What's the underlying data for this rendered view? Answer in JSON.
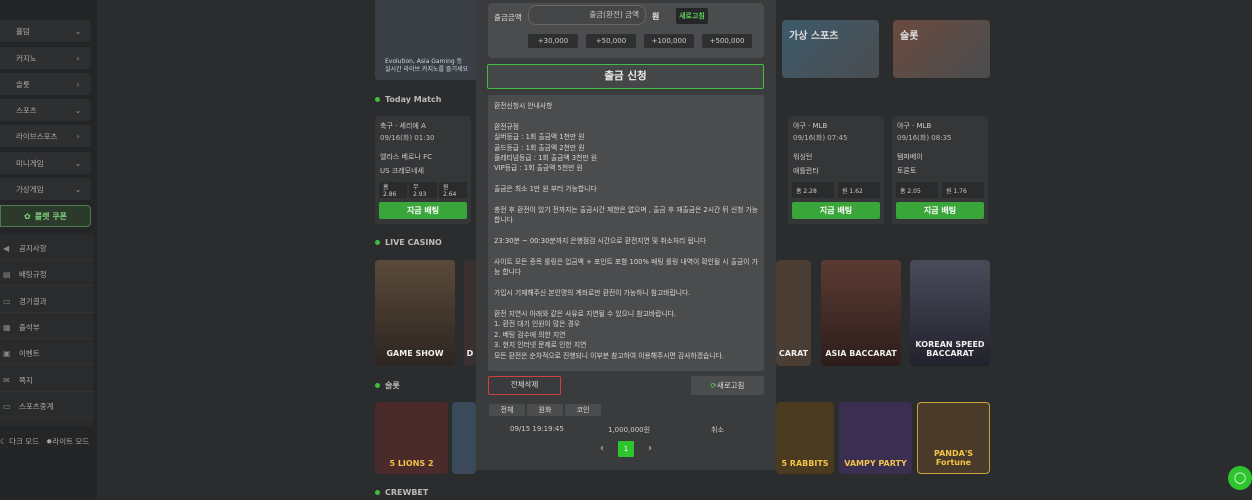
{
  "sidebar": {
    "items": [
      {
        "label": "카지노",
        "chevron": "›"
      },
      {
        "label": "슬롯",
        "chevron": "›"
      },
      {
        "label": "스포츠",
        "chevron": "⌄"
      },
      {
        "label": "라이브스포츠",
        "chevron": "›"
      },
      {
        "label": "미니게임",
        "chevron": "⌄"
      },
      {
        "label": "가상게임",
        "chevron": "⌄"
      }
    ],
    "top_item": {
      "label": "홀덤",
      "chevron": "⌄"
    },
    "coupon": "룰렛 쿠폰",
    "menu": [
      "공지사항",
      "배팅규정",
      "경기결과",
      "출석부",
      "이벤트",
      "쪽지",
      "스포츠중계"
    ],
    "dark_mode": "다크 모드",
    "light_mode": "라이트 모드"
  },
  "main": {
    "banner_text": "Evolution, Asia Gaming 등\n실시간 라이브 카지노를 즐기세요",
    "tiles": [
      "가상 스포츠",
      "슬롯"
    ],
    "today_match": "Today Match",
    "live_casino": "LIVE CASINO",
    "slots": "슬롯",
    "crewbet": "CREWBET",
    "matches": [
      {
        "league": "축구 · 세리에 A",
        "date": "09/16(화) 01:30",
        "home": "엘라스 베로나 FC",
        "away": "US 크레모네세",
        "odds": [
          "홈 2.86",
          "무 2.93",
          "원 2.64"
        ],
        "bet": "지금 배팅"
      },
      {
        "league": "야구 · MLB",
        "date": "09/16(화) 07:45",
        "home": "워싱턴",
        "away": "애틀란타",
        "odds": [
          "홈 2.28",
          "원 1.62"
        ],
        "bet": "지금 배팅"
      },
      {
        "league": "야구 · MLB",
        "date": "09/16(화) 08:35",
        "home": "탬파베이",
        "away": "토론토",
        "odds": [
          "홈 2.05",
          "원 1.76"
        ],
        "bet": "지금 배팅"
      }
    ],
    "casino_cards": [
      "GAME SHOW",
      "D",
      "CARAT",
      "ASIA BACCARAT",
      "KOREAN SPEED BACCARAT"
    ],
    "slot_cards": [
      "5 LIONS 2",
      "5 RABBITS",
      "VAMPY PARTY",
      "PANDA'S Fortune"
    ]
  },
  "modal": {
    "amount_label": "출금금액",
    "amount_placeholder": "출금(환전) 금액",
    "won": "원",
    "refresh": "새로고침",
    "quick": [
      "+30,000",
      "+50,000",
      "+100,000",
      "+500,000"
    ],
    "submit": "출금 신청",
    "notice": [
      "환전신청시 안내사항",
      "",
      "환전규정",
      "실버등급 : 1회 출금액 1천만 원",
      "골드등급 : 1회 출금액 2천만 원",
      "플레티넘등급 : 1회 출금액 3천만 원",
      "VIP등급 : 1회 출금액 5천만 원",
      "",
      "출금은 최소 1만 원 부터 가능합니다",
      "",
      "충전 후 환전이 있기 전까지는 출금시간 제한은 없으며 , 출금 후 재출금은 2시간 뒤 신청 가능합니다",
      "",
      "23:30분 ~ 00:30분까지 은행점검 시간으로 환전지연 및 취소처리 됩니다",
      "",
      "사이트 모든 종목 롤링은 입금액 + 포인트 포함 100% 배팅 롤링 내역이 확인될 시 출금이 가능 합니다",
      "",
      "가입시 기재해주신 본인명의 계좌로만 환전이 가능하니 참고바랍니다.",
      "",
      "환전 지연시 아래와 같은 사유로 지연될 수 있으니 참고바랍니다.",
      "1. 환전 대기 인원이 많은 경우",
      "2. 베팅 검수에 의한 지연",
      "3. 현지 인터넷 문제로 인한 지연",
      "모든 환전은 순차적으로 진행되니 이부분 참고하여 이용해주시면 감사하겠습니다."
    ],
    "delete_all": "전체삭제",
    "refresh2": "새로고침",
    "filters": [
      "전체",
      "원화",
      "코인"
    ],
    "history": {
      "time": "09/15 19:19:45",
      "amount": "1,000,000원",
      "action": "취소"
    },
    "page": "1",
    "prev": "‹",
    "next": "›"
  },
  "fab_icon": "chat-icon"
}
